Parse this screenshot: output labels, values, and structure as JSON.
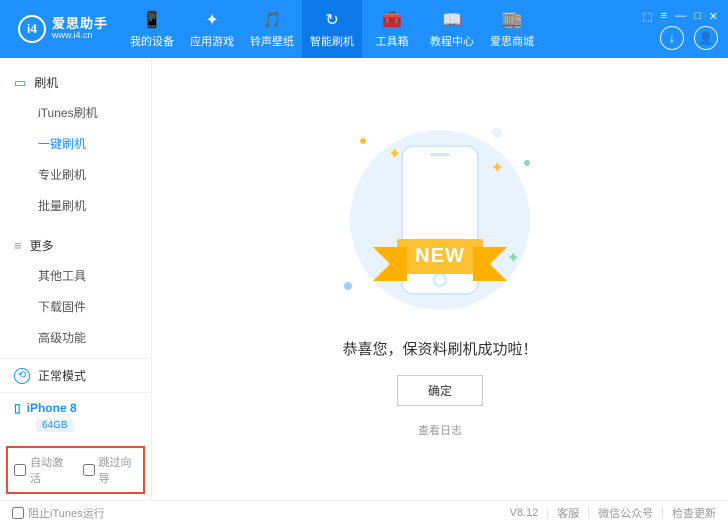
{
  "brand": {
    "name": "爱思助手",
    "site": "www.i4.cn",
    "badge": "i4"
  },
  "nav": [
    {
      "label": "我的设备",
      "icon": "📱"
    },
    {
      "label": "应用游戏",
      "icon": "✦"
    },
    {
      "label": "铃声壁纸",
      "icon": "🎵"
    },
    {
      "label": "智能刷机",
      "icon": "↻",
      "active": true
    },
    {
      "label": "工具箱",
      "icon": "🧰"
    },
    {
      "label": "教程中心",
      "icon": "📖"
    },
    {
      "label": "爱思商城",
      "icon": "🏬"
    }
  ],
  "header_icons": {
    "download": "↓",
    "user": "👤"
  },
  "win_controls": [
    "⬚",
    "≡",
    "—",
    "□",
    "✕"
  ],
  "sidebar": {
    "group1": {
      "title": "刷机",
      "icon": "▭",
      "items": [
        "iTunes刷机",
        "一键刷机",
        "专业刷机",
        "批量刷机"
      ],
      "activeIndex": 1
    },
    "group2": {
      "title": "更多",
      "icon": "≡",
      "items": [
        "其他工具",
        "下载固件",
        "高级功能"
      ]
    },
    "mode": "正常模式",
    "device": {
      "name": "iPhone 8",
      "storage": "64GB"
    },
    "activation": {
      "auto_activate": "自动激活",
      "skip_wizard": "跳过向导"
    }
  },
  "content": {
    "ribbon": "NEW",
    "success": "恭喜您，保资料刷机成功啦！",
    "ok": "确定",
    "view_log": "查看日志"
  },
  "footer": {
    "block_itunes": "阻止iTunes运行",
    "version": "V8.12",
    "support": "客服",
    "wechat": "微信公众号",
    "update": "检查更新"
  }
}
